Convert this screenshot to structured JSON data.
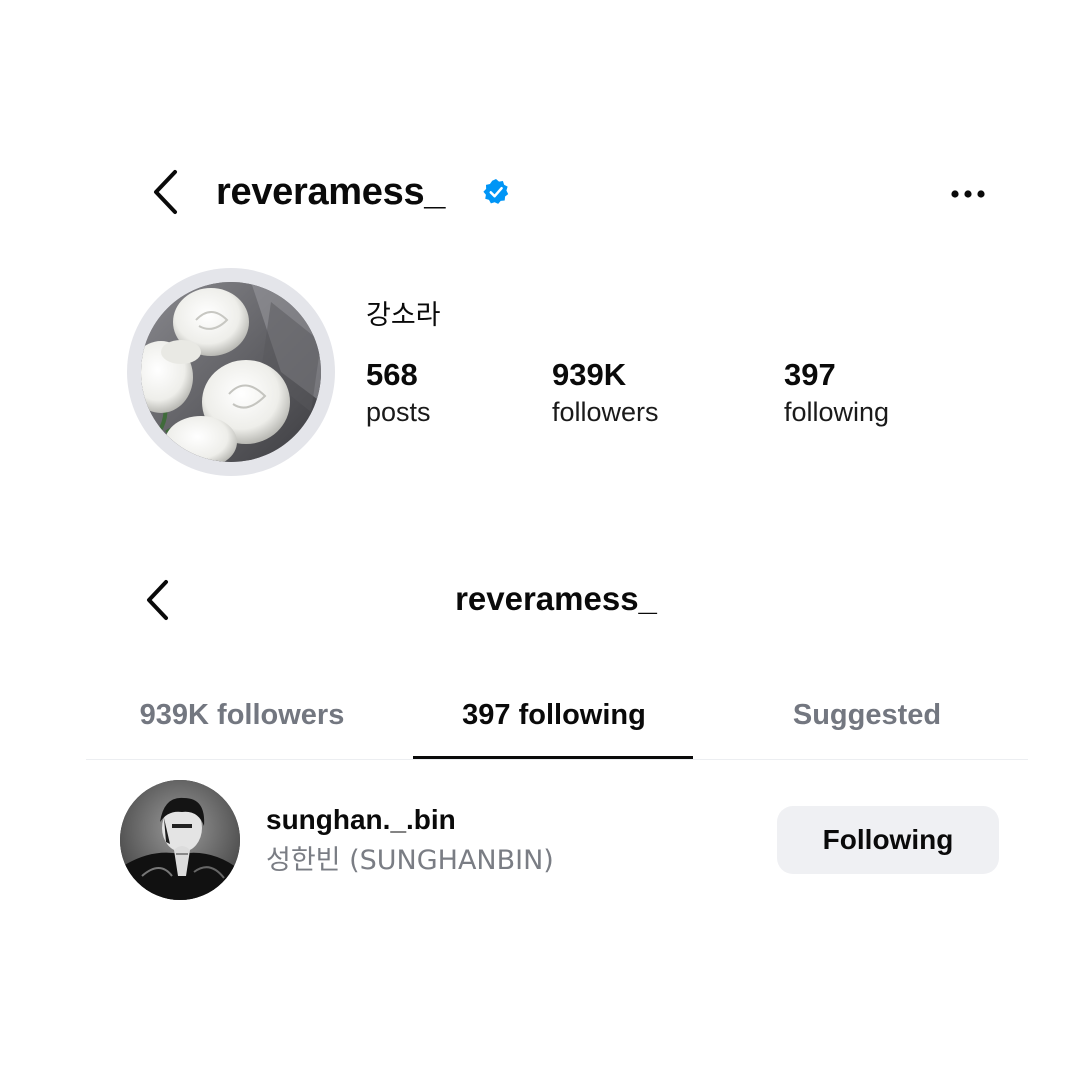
{
  "profile": {
    "username": "reveramess_",
    "display_name": "강소라",
    "stats": {
      "posts_count": "568",
      "posts_label": "posts",
      "followers_count": "939K",
      "followers_label": "followers",
      "following_count": "397",
      "following_label": "following"
    }
  },
  "following_list": {
    "title": "reveramess_",
    "tabs": [
      {
        "label": "939K followers",
        "active": false
      },
      {
        "label": "397 following",
        "active": true
      },
      {
        "label": "Suggested",
        "active": false
      }
    ],
    "rows": [
      {
        "username": "sunghan._.bin",
        "full_name": "성한빈 (SUNGHANBIN)",
        "button_label": "Following"
      }
    ]
  },
  "colors": {
    "verified_blue": "#0095f6",
    "tab_inactive": "#737780",
    "button_bg": "#eff0f3"
  },
  "icons": {
    "back": "chevron-left-icon",
    "verified": "verified-badge-icon",
    "more": "more-horizontal-icon"
  }
}
